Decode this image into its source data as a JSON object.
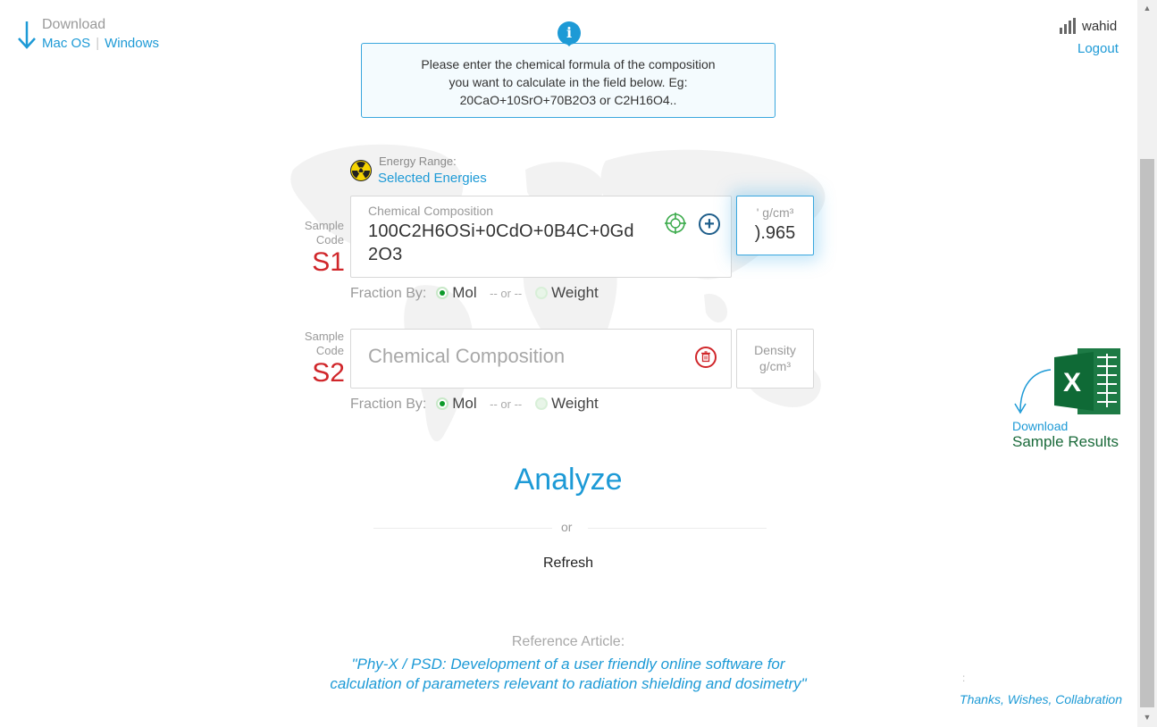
{
  "download": {
    "title": "Download",
    "mac": "Mac OS",
    "windows": "Windows"
  },
  "user": {
    "name": "wahid",
    "logout": "Logout"
  },
  "info": {
    "line1": "Please enter the chemical formula of the composition",
    "line2": "you want to calculate in the field below. Eg:",
    "line3": "20CaO+10SrO+70B2O3 or C2H16O4.."
  },
  "energy": {
    "label": "Energy Range:",
    "value": "Selected Energies"
  },
  "samples": [
    {
      "code_label_1": "Sample",
      "code_label_2": "Code",
      "code": "S1",
      "comp_label": "Chemical Composition",
      "comp_value_line1": "100C2H6OSi+0CdO+0B4C+0Gd",
      "comp_value_line2": "2O3",
      "density_label": "' g/cm³",
      "density_value": ").965",
      "fraction_label": "Fraction By:",
      "opt_mol": "Mol",
      "or": "-- or --",
      "opt_weight": "Weight",
      "selected": "Mol"
    },
    {
      "code_label_1": "Sample",
      "code_label_2": "Code",
      "code": "S2",
      "comp_placeholder": "Chemical Composition",
      "density_label_1": "Density",
      "density_label_2": "g/cm³",
      "fraction_label": "Fraction By:",
      "opt_mol": "Mol",
      "or": "-- or --",
      "opt_weight": "Weight",
      "selected": "Mol"
    }
  ],
  "actions": {
    "analyze": "Analyze",
    "or": "or",
    "refresh": "Refresh"
  },
  "excel": {
    "download": "Download",
    "label": "Sample Results",
    "letter": "X"
  },
  "reference": {
    "label": "Reference Article:",
    "line1": "\"Phy-X / PSD: Development of a user friendly online software for",
    "line2": "calculation of parameters relevant to radiation shielding and dosimetry\""
  },
  "footer": {
    "colon": ":",
    "thanks": "Thanks, Wishes, Collabration"
  },
  "colors": {
    "accent": "#1d9ad6",
    "sample_code": "#d0262a",
    "excel_green": "#1a6a3a"
  }
}
